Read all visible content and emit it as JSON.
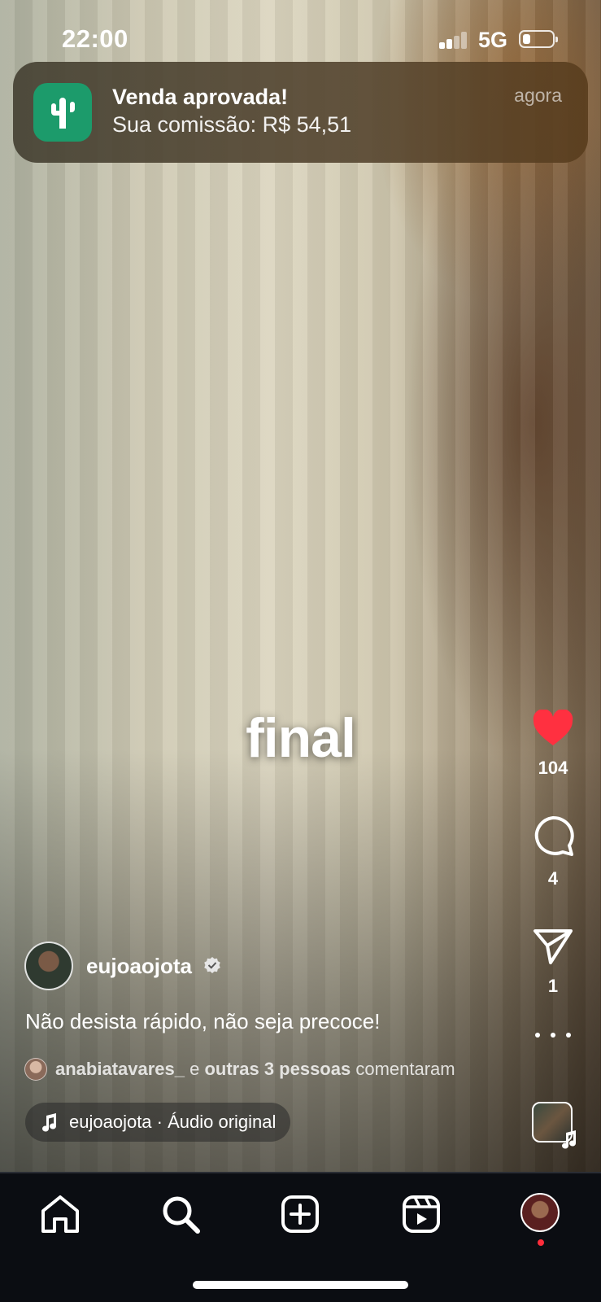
{
  "status_bar": {
    "time": "22:00",
    "network": "5G",
    "battery_percent": 25,
    "signal_bars": 2,
    "signal_bars_total": 4
  },
  "notification": {
    "app_icon": "cactus-icon",
    "title": "Venda aprovada!",
    "body": "Sua comissão: R$ 54,51",
    "time": "agora"
  },
  "video": {
    "overlay_caption": "final"
  },
  "actions": {
    "like_count": "104",
    "comment_count": "4",
    "share_count": "1",
    "icons": [
      "heart-icon",
      "comment-icon",
      "share-icon",
      "more-icon",
      "audio-thumbnail"
    ]
  },
  "post": {
    "username": "eujoaojota",
    "verified": true,
    "caption": "Não desista rápido, não seja precoce!",
    "commenters": {
      "user": "anabiatavares_",
      "connector": " e ",
      "others": "outras 3 pessoas",
      "suffix": " comentaram"
    },
    "audio": "eujoaojota · Áudio original"
  },
  "colors": {
    "like_active": "#ff3040",
    "app_icon_bg": "#1c9b6b",
    "nav_bg": "#0b0d12"
  },
  "bottom_nav": {
    "items": [
      "home-icon",
      "search-icon",
      "create-icon",
      "reels-icon",
      "profile-avatar"
    ],
    "profile_has_notification": true
  }
}
